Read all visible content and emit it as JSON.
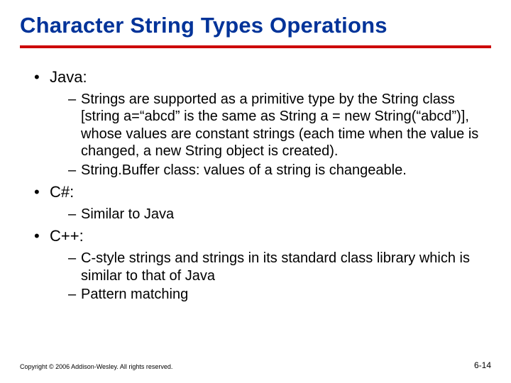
{
  "title": "Character String Types Operations",
  "bullets": {
    "java": {
      "label": "Java:",
      "items": [
        "Strings are supported as a primitive type by the String class [string a=“abcd” is the same as String a = new String(“abcd”)], whose values are constant strings (each time when the value is changed, a new String object is created).",
        "String.Buffer class: values of a string is changeable."
      ]
    },
    "csharp": {
      "label": "C#:",
      "items": [
        "Similar to Java"
      ]
    },
    "cpp": {
      "label": "C++:",
      "items": [
        "C-style strings and strings in its standard class library which is similar to that of Java",
        "Pattern matching"
      ]
    }
  },
  "footer": {
    "copyright": "Copyright © 2006 Addison-Wesley. All rights reserved.",
    "page": "6-14"
  }
}
